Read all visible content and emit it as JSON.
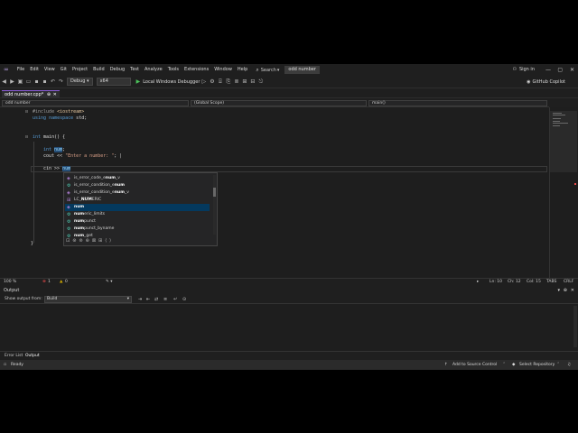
{
  "menubar": {
    "items": [
      "File",
      "Edit",
      "View",
      "Git",
      "Project",
      "Build",
      "Debug",
      "Test",
      "Analyze",
      "Tools",
      "Extensions",
      "Window",
      "Help"
    ],
    "search_label": "Search",
    "solution_name": "odd number",
    "signin_label": "Sign in"
  },
  "toolbar": {
    "config": "Debug",
    "platform": "x64",
    "run_label": "Local Windows Debugger",
    "copilot_label": "GitHub Copilot"
  },
  "tabs": {
    "active_file": "odd number.cpp*"
  },
  "navbar": {
    "project": "odd number",
    "scope": "(Global Scope)",
    "member": "main()"
  },
  "code": {
    "line1_directive": "#include",
    "line1_header": "<iostream>",
    "line2_kw1": "using",
    "line2_kw2": "namespace",
    "line2_rest": " std;",
    "line4_kw": "int",
    "line4_rest": " main() {",
    "line6_kw": "int",
    "line6_var": "num",
    "line6_end": ";",
    "line7_start": "cout << ",
    "line7_str": "\"Enter a number: \"",
    "line7_end": "; |",
    "line9_start": "cin >> ",
    "line9_typed": "num",
    "line_close_main": "}"
  },
  "autocomplete": {
    "items": [
      {
        "pre": "is_error_code_e",
        "match": "num",
        "post": "_v",
        "icon": "variable-icon"
      },
      {
        "pre": "is_error_condition_e",
        "match": "num",
        "post": "",
        "icon": "class-icon"
      },
      {
        "pre": "is_error_condition_e",
        "match": "num",
        "post": "_v",
        "icon": "variable-icon"
      },
      {
        "pre": "LC_",
        "match": "NUM",
        "post": "ERIC",
        "icon": "macro-icon"
      },
      {
        "pre": "",
        "match": "num",
        "post": "",
        "icon": "variable-icon"
      },
      {
        "pre": "",
        "match": "num",
        "post": "eric_limits",
        "icon": "class-icon"
      },
      {
        "pre": "",
        "match": "num",
        "post": "punct",
        "icon": "class-icon"
      },
      {
        "pre": "",
        "match": "num",
        "post": "punct_byname",
        "icon": "class-icon"
      },
      {
        "pre": "",
        "match": "num",
        "post": "_get",
        "icon": "class-icon"
      }
    ],
    "selected_index": 4
  },
  "editor_status": {
    "zoom": "100 %",
    "errors": "1",
    "warnings": "0",
    "line": "Ln: 10",
    "char": "Ch: 12",
    "col": "Col: 15",
    "tabs": "TABS",
    "eol": "CRLF"
  },
  "output": {
    "title": "Output",
    "show_from_label": "Show output from:",
    "source": "Build"
  },
  "bottom_tabs": [
    "Error List",
    "Output"
  ],
  "statusbar": {
    "ready": "Ready",
    "source_control": "Add to Source Control",
    "repo": "Select Repository"
  },
  "colors": {
    "accent": "#8a5bd6",
    "run_green": "#4cc35b",
    "error_red": "#f14c4c",
    "selection_blue": "#04395e"
  }
}
